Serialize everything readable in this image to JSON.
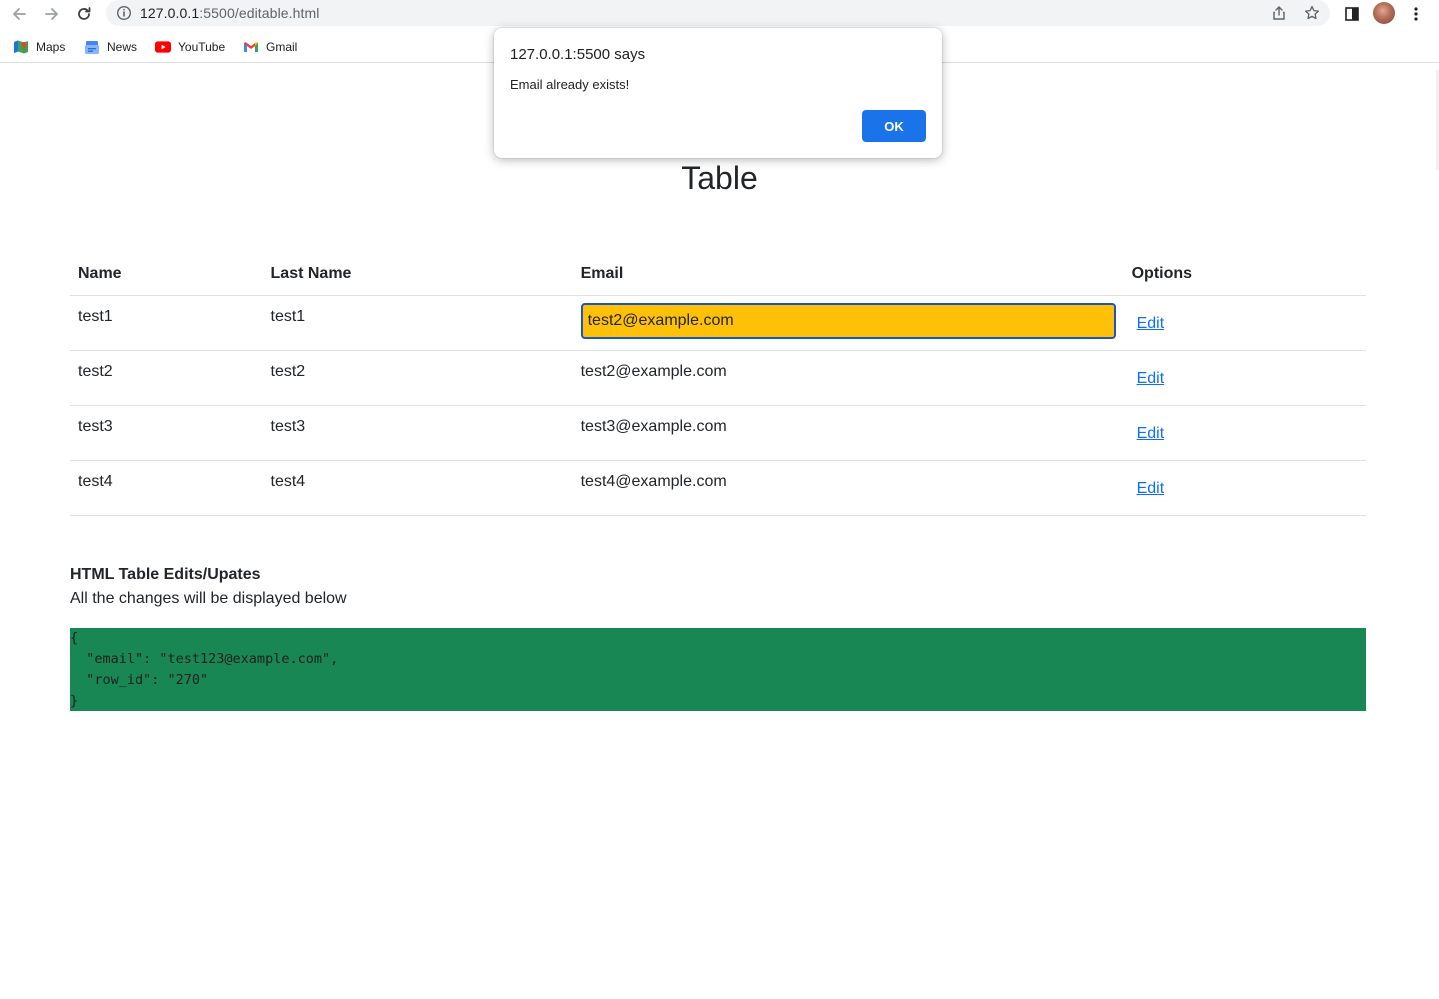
{
  "browser": {
    "url_host": "127.0.0.1",
    "url_rest": ":5500/editable.html",
    "bookmarks": [
      {
        "label": "Maps",
        "icon": "maps-icon"
      },
      {
        "label": "News",
        "icon": "news-icon"
      },
      {
        "label": "YouTube",
        "icon": "youtube-icon"
      },
      {
        "label": "Gmail",
        "icon": "gmail-icon"
      }
    ]
  },
  "page": {
    "title": "Table",
    "table": {
      "headers": [
        "Name",
        "Last Name",
        "Email",
        "Options"
      ],
      "rows": [
        {
          "name": "test1",
          "last_name": "test1",
          "email": "test2@example.com",
          "editing": true,
          "option": "Edit"
        },
        {
          "name": "test2",
          "last_name": "test2",
          "email": "test2@example.com",
          "option": "Edit"
        },
        {
          "name": "test3",
          "last_name": "test3",
          "email": "test3@example.com",
          "option": "Edit"
        },
        {
          "name": "test4",
          "last_name": "test4",
          "email": "test4@example.com",
          "option": "Edit"
        }
      ]
    },
    "edits": {
      "title": "HTML Table Edits/Upates",
      "subtitle": "All the changes will be displayed below",
      "json_lines": [
        "{",
        "  \"email\": \"test123@example.com\",",
        "  \"row_id\": \"270\"",
        "}"
      ]
    }
  },
  "dialog": {
    "title": "127.0.0.1:5500 says",
    "message": "Email already exists!",
    "ok_label": "OK"
  },
  "colors": {
    "input_highlight": "#ffc107",
    "json_background": "#198754",
    "link": "#0d6efd",
    "ok_button": "#1a73e8"
  }
}
